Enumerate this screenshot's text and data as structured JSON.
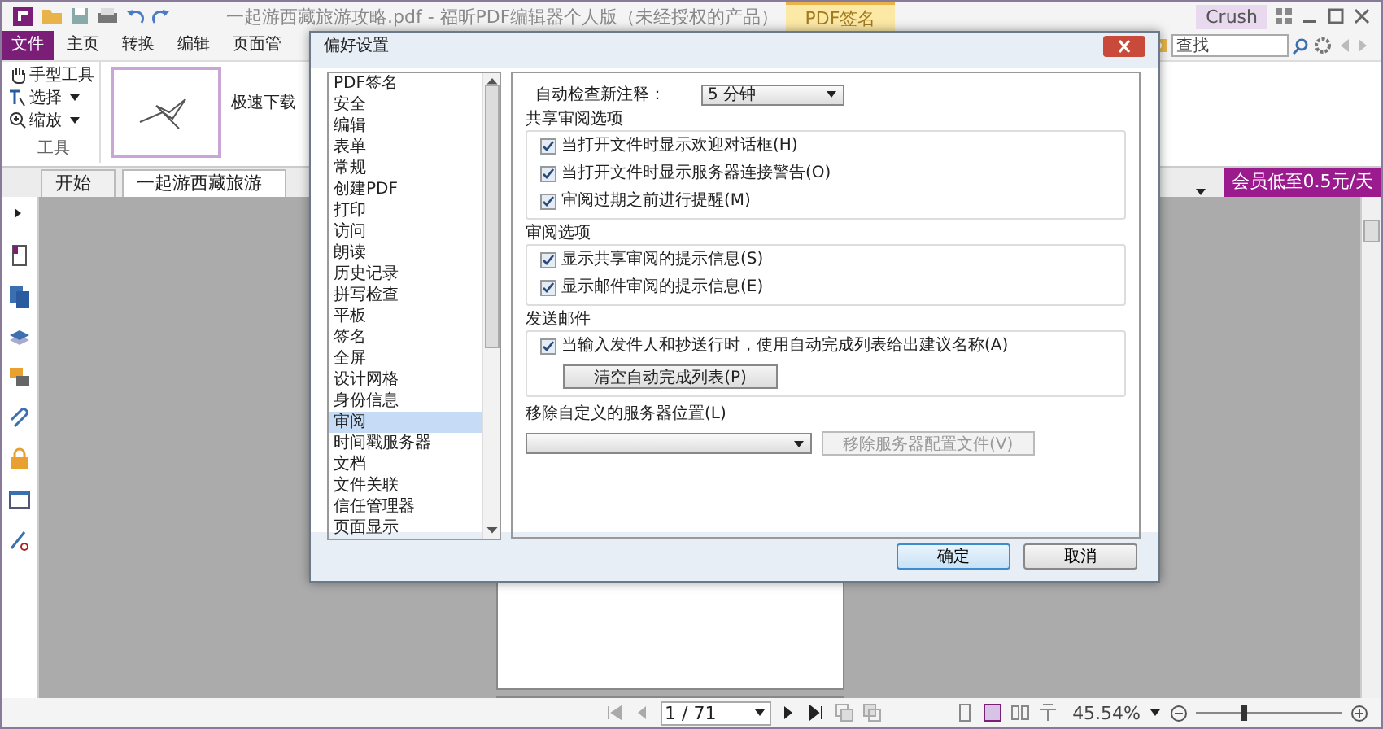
{
  "window": {
    "title": "一起游西藏旅游攻略.pdf - 福昕PDF编辑器个人版（未经授权的产品）",
    "context_tab": "PDF签名",
    "user": "Crush"
  },
  "ribbon_tabs": [
    {
      "label": "文件",
      "selected": true
    },
    {
      "label": "主页",
      "selected": false
    },
    {
      "label": "转换",
      "selected": false
    },
    {
      "label": "编辑",
      "selected": false
    },
    {
      "label": "页面管",
      "selected": false
    }
  ],
  "search": {
    "placeholder": "查找"
  },
  "tools_group": {
    "items": [
      {
        "label": "手型工具",
        "kind": "hand",
        "dropdown": false
      },
      {
        "label": "选择",
        "kind": "select",
        "dropdown": true
      },
      {
        "label": "缩放",
        "kind": "zoom",
        "dropdown": true
      }
    ],
    "caption": "工具"
  },
  "signature_text": "极速下载",
  "doc_tabs": [
    {
      "label": "开始",
      "selected": false
    },
    {
      "label": "一起游西藏旅游",
      "selected": true
    }
  ],
  "promo": "会员低至0.5元/天",
  "status_bar": {
    "page": "1 / 71",
    "zoom": "45.54%",
    "zoom_slider": {
      "level": 0.32
    }
  },
  "dialog": {
    "title": "偏好设置",
    "categories": [
      {
        "label": "PDF签名",
        "selected": false
      },
      {
        "label": "安全",
        "selected": false
      },
      {
        "label": "编辑",
        "selected": false
      },
      {
        "label": "表单",
        "selected": false
      },
      {
        "label": "常规",
        "selected": false
      },
      {
        "label": "创建PDF",
        "selected": false
      },
      {
        "label": "打印",
        "selected": false
      },
      {
        "label": "访问",
        "selected": false
      },
      {
        "label": "朗读",
        "selected": false
      },
      {
        "label": "历史记录",
        "selected": false
      },
      {
        "label": "拼写检查",
        "selected": false
      },
      {
        "label": "平板",
        "selected": false
      },
      {
        "label": "签名",
        "selected": false
      },
      {
        "label": "全屏",
        "selected": false
      },
      {
        "label": "设计网格",
        "selected": false
      },
      {
        "label": "身份信息",
        "selected": false
      },
      {
        "label": "审阅",
        "selected": true
      },
      {
        "label": "时间戳服务器",
        "selected": false
      },
      {
        "label": "文档",
        "selected": false
      },
      {
        "label": "文件关联",
        "selected": false
      },
      {
        "label": "信任管理器",
        "selected": false
      },
      {
        "label": "页面显示",
        "selected": false
      }
    ],
    "auto_check": {
      "label": "自动检查新注释：",
      "value": "5 分钟"
    },
    "groups": [
      {
        "title": "共享审阅选项",
        "options": [
          {
            "label": "当打开文件时显示欢迎对话框(H)",
            "checked": true
          },
          {
            "label": "当打开文件时显示服务器连接警告(O)",
            "checked": true
          },
          {
            "label": "审阅过期之前进行提醒(M)",
            "checked": true
          }
        ]
      },
      {
        "title": "审阅选项",
        "options": [
          {
            "label": "显示共享审阅的提示信息(S)",
            "checked": true
          },
          {
            "label": "显示邮件审阅的提示信息(E)",
            "checked": true
          }
        ]
      },
      {
        "title": "发送邮件",
        "options": [
          {
            "label": "当输入发件人和抄送行时，使用自动完成列表给出建议名称(A)",
            "checked": true
          }
        ],
        "button": {
          "label": "清空自动完成列表(P)",
          "disabled": false
        }
      }
    ],
    "server": {
      "label": "移除自定义的服务器位置(L)",
      "button": {
        "label": "移除服务器配置文件(V)",
        "disabled": true
      }
    },
    "buttons": [
      {
        "label": "确定",
        "default": true
      },
      {
        "label": "取消",
        "default": false
      }
    ]
  }
}
